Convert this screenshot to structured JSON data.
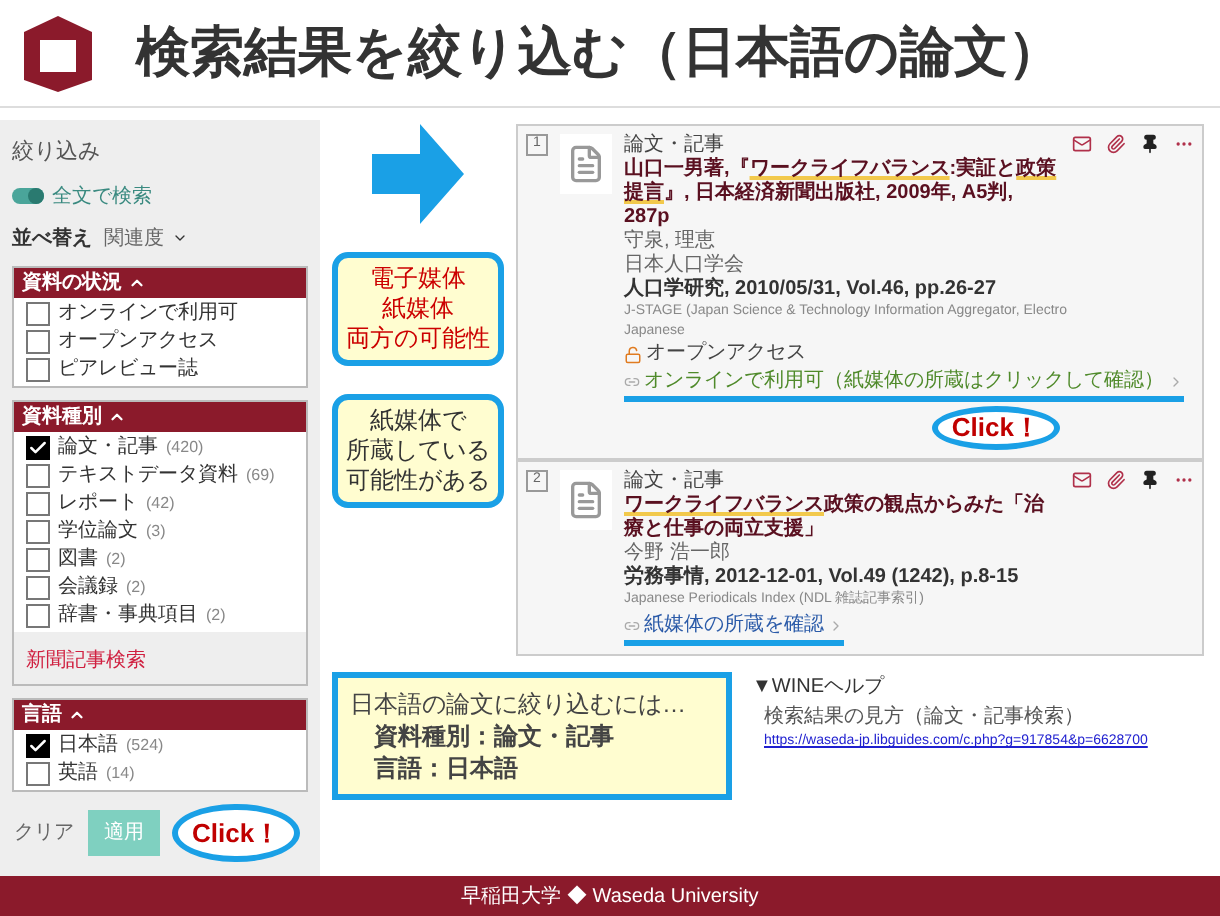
{
  "slide_title": "検索結果を絞り込む（日本語の論文）",
  "sidebar": {
    "heading": "絞り込み",
    "toggle": {
      "label": "全文で検索",
      "on": true
    },
    "sort": {
      "label": "並べ替え",
      "value": "関連度"
    },
    "facets": [
      {
        "title": "資料の状況",
        "expanded": true,
        "options": [
          {
            "label": "オンラインで利用可",
            "checked": false
          },
          {
            "label": "オープンアクセス",
            "checked": false
          },
          {
            "label": "ピアレビュー誌",
            "checked": false
          }
        ]
      },
      {
        "title": "資料種別",
        "expanded": true,
        "options": [
          {
            "label": "論文・記事",
            "count": "(420)",
            "checked": true
          },
          {
            "label": "テキストデータ資料",
            "count": "(69)",
            "checked": false
          },
          {
            "label": "レポート",
            "count": "(42)",
            "checked": false
          },
          {
            "label": "学位論文",
            "count": "(3)",
            "checked": false
          },
          {
            "label": "図書",
            "count": "(2)",
            "checked": false
          },
          {
            "label": "会議録",
            "count": "(2)",
            "checked": false
          },
          {
            "label": "辞書・事典項目",
            "count": "(2)",
            "checked": false
          }
        ],
        "link": "新聞記事検索"
      },
      {
        "title": "言語",
        "expanded": true,
        "options": [
          {
            "label": "日本語",
            "count": "(524)",
            "checked": true
          },
          {
            "label": "英語",
            "count": "(14)",
            "checked": false
          }
        ]
      }
    ],
    "clear_button": "クリア",
    "apply_button": "適用",
    "apply_callout": "Click！"
  },
  "notes": [
    {
      "lines": [
        "電子媒体",
        "紙媒体",
        "両方の可能性"
      ],
      "color": "#cc0000"
    },
    {
      "lines": [
        "紙媒体で",
        "所蔵している",
        "可能性がある"
      ],
      "color": "#333333"
    }
  ],
  "results": [
    {
      "number": "1",
      "type": "論文・記事",
      "title": [
        {
          "text": "山口一男著,『",
          "highlighted": false
        },
        {
          "text": "ワークライフバランス",
          "highlighted": true
        },
        {
          "text": ":実証と",
          "highlighted": false
        },
        {
          "text": "政策提言",
          "highlighted": true
        },
        {
          "text": "』, 日本経済新聞出版社, 2009年, A5判, 287p",
          "highlighted": false
        }
      ],
      "details": [
        "守泉, 理恵",
        "日本人口学会"
      ],
      "journal": "人口学研究, 2010/05/31, Vol.46, pp.26-27",
      "source": "J-STAGE (Japan Science & Technology Information Aggregator, Electro",
      "language": "Japanese",
      "open_access": "オープンアクセス",
      "link": {
        "kind": "online",
        "text": "オンラインで利用可（紙媒体の所蔵はクリックして確認）",
        "annotated": true,
        "callout": "Click！"
      }
    },
    {
      "number": "2",
      "type": "論文・記事",
      "title": [
        {
          "text": "ワークライフバランス",
          "highlighted": true
        },
        {
          "text": "政策の観点からみた「治療と仕事の両立支援」",
          "highlighted": false
        }
      ],
      "details": [
        "今野 浩一郎"
      ],
      "journal": "労務事情, 2012-12-01, Vol.49 (1242), p.8-15",
      "source": "Japanese Periodicals Index (NDL 雑誌記事索引)",
      "link": {
        "kind": "print",
        "text": "紙媒体の所蔵を確認",
        "annotated": true
      }
    }
  ],
  "summary": {
    "lines": [
      {
        "text": "日本語の論文に絞り込むには…",
        "bold": false
      },
      {
        "text": "資料種別：論文・記事",
        "bold": true
      },
      {
        "text": "言語：日本語",
        "bold": true
      }
    ]
  },
  "help": {
    "heading": "▼WINEヘルプ",
    "title": "検索結果の見方（論文・記事検索）",
    "url": "https://waseda-jp.libguides.com/c.php?g=917854&p=6628700"
  },
  "footer": "早稲田大学 ◆ Waseda University"
}
